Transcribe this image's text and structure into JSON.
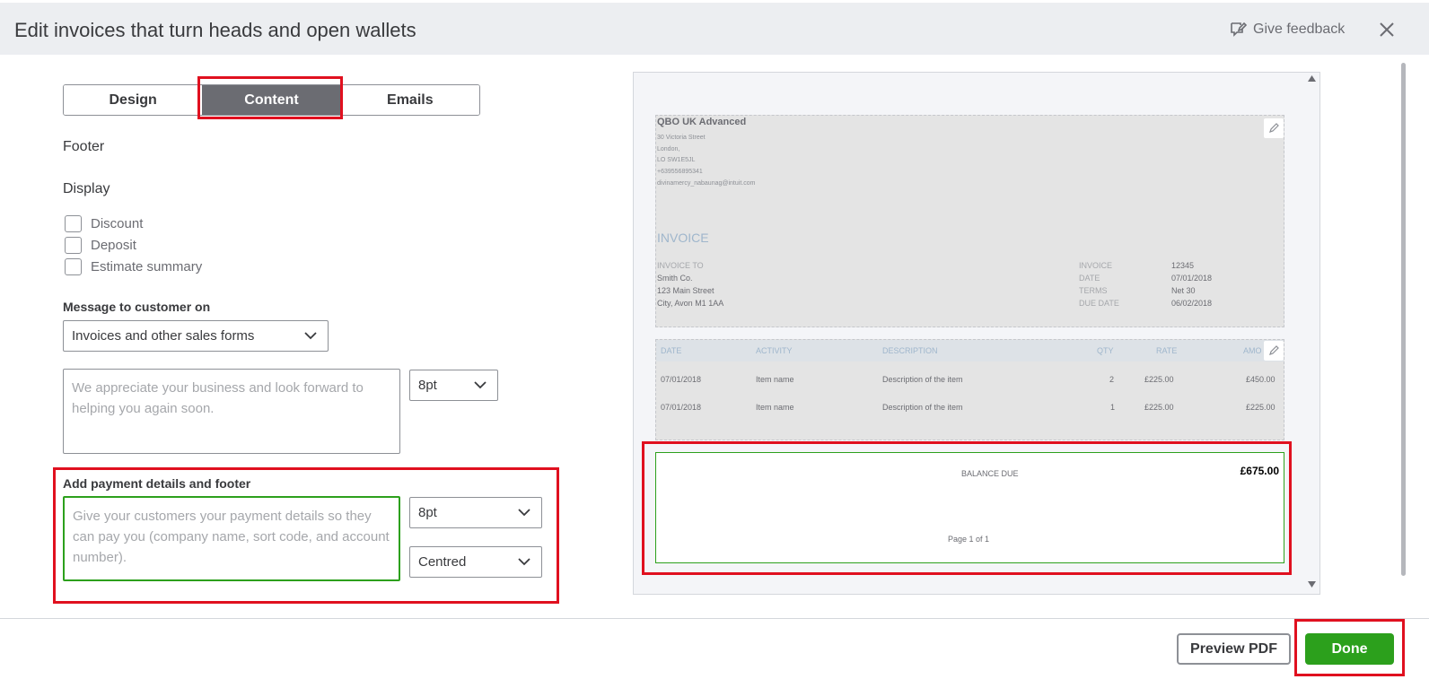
{
  "header": {
    "title": "Edit invoices that turn heads and open wallets",
    "feedback_label": "Give feedback"
  },
  "tabs": [
    {
      "label": "Design"
    },
    {
      "label": "Content",
      "active": true
    },
    {
      "label": "Emails"
    }
  ],
  "footer_section": {
    "heading": "Footer",
    "display_label": "Display",
    "checkboxes": [
      {
        "label": "Discount",
        "checked": false
      },
      {
        "label": "Deposit",
        "checked": false
      },
      {
        "label": "Estimate summary",
        "checked": false
      }
    ],
    "message_label": "Message to customer on",
    "message_select": "Invoices and other sales forms",
    "message_placeholder": "We appreciate your business and look forward to helping you again soon.",
    "message_size": "8pt",
    "payment_label": "Add payment details and footer",
    "payment_placeholder": "Give your customers your payment details so they can pay you (company name, sort code, and account number).",
    "payment_size": "8pt",
    "payment_align": "Centred"
  },
  "invoice": {
    "company_name": "QBO UK Advanced",
    "address_lines": [
      "30 Victoria Street",
      "London,",
      "LO SW1E5JL",
      "+639556895341",
      "divinamercy_nabaunag@intuit.com"
    ],
    "doc_title": "INVOICE",
    "bill_label": "INVOICE TO",
    "bill_lines": [
      "Smith Co.",
      "123 Main Street",
      "City, Avon M1 1AA"
    ],
    "meta": [
      {
        "label": "INVOICE",
        "value": "12345"
      },
      {
        "label": "DATE",
        "value": "07/01/2018"
      },
      {
        "label": "TERMS",
        "value": "Net 30"
      },
      {
        "label": "DUE DATE",
        "value": "06/02/2018"
      }
    ],
    "columns": [
      "DATE",
      "ACTIVITY",
      "DESCRIPTION",
      "QTY",
      "RATE",
      "AMO"
    ],
    "rows": [
      {
        "date": "07/01/2018",
        "activity": "Item name",
        "description": "Description of the item",
        "qty": "2",
        "rate": "£225.00",
        "amount": "£450.00"
      },
      {
        "date": "07/01/2018",
        "activity": "Item name",
        "description": "Description of the item",
        "qty": "1",
        "rate": "£225.00",
        "amount": "£225.00"
      }
    ],
    "balance_label": "BALANCE DUE",
    "balance_value": "£675.00",
    "page_label": "Page 1 of 1"
  },
  "buttons": {
    "preview": "Preview PDF",
    "done": "Done"
  },
  "colors": {
    "highlight": "#e0101f",
    "primary": "#2ca01c",
    "tab_active": "#6b6c72",
    "header_bg": "#eceef1"
  }
}
